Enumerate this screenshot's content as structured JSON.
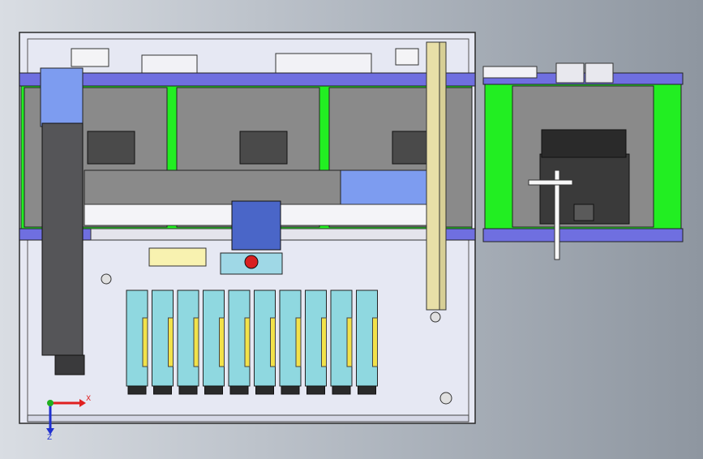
{
  "viewport": {
    "background_gradient": [
      "#d9dde3",
      "#aeb5be",
      "#8e96a0"
    ]
  },
  "colors": {
    "frame_fill": "#e6e8f3",
    "frame_stroke": "#2a2a2a",
    "conveyor_green": "#22ee22",
    "rail_blue": "#6f6fe0",
    "tray_gray": "#8a8a8a",
    "tray_dark": "#4a4a4a",
    "gantry_blue": "#7d9cf0",
    "head_blue": "#4a66c8",
    "feeder_cyan": "#8fd8e0",
    "feeder_yellow": "#f2e24a",
    "rail_tan": "#e8dfa8",
    "arm_dark": "#555558",
    "button_red": "#d82020"
  },
  "icons": {
    "triad": "coordinate-triad-icon",
    "stop_button": "emergency-stop-icon"
  },
  "triad": {
    "x_label": "X",
    "z_label": "Z",
    "x_color": "#e02020",
    "z_color": "#2030d0",
    "y_color": "#20b020"
  },
  "machine": {
    "tray_stations": 3,
    "feeders": 10
  }
}
